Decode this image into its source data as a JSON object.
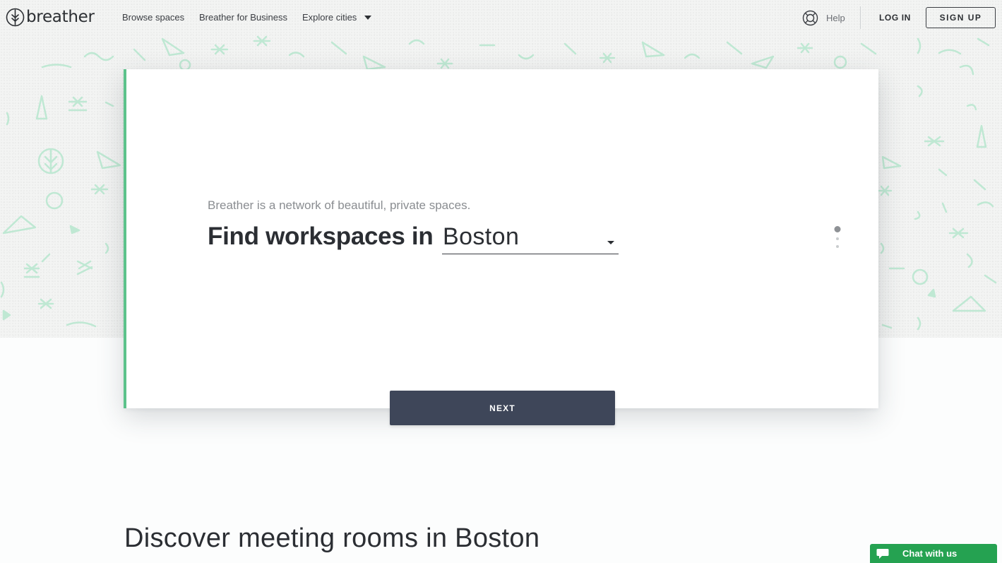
{
  "header": {
    "logo_text": "breather",
    "nav": {
      "browse": "Browse spaces",
      "business": "Breather for Business",
      "cities": "Explore cities"
    },
    "help": "Help",
    "login": "LOG IN",
    "signup": "SIGN UP"
  },
  "hero": {
    "subtitle": "Breather is a network of beautiful, private spaces.",
    "headline": "Find workspaces in",
    "city": "Boston",
    "next": "NEXT",
    "steps": {
      "total": 3,
      "current": 1
    }
  },
  "section": {
    "title": "Discover meeting rooms in Boston"
  },
  "chat": {
    "label": "Chat with us"
  },
  "colors": {
    "accent_green": "#5cc28b",
    "button_dark": "#3e4659",
    "chat_green": "#25a251",
    "pattern_mint": "#bfe8d3"
  },
  "icons": {
    "logo": "tree-circle-icon",
    "help": "lifebuoy-icon",
    "cities_dropdown": "caret-down-icon",
    "city_dropdown": "caret-down-icon",
    "chat": "speech-bubble-icon"
  }
}
